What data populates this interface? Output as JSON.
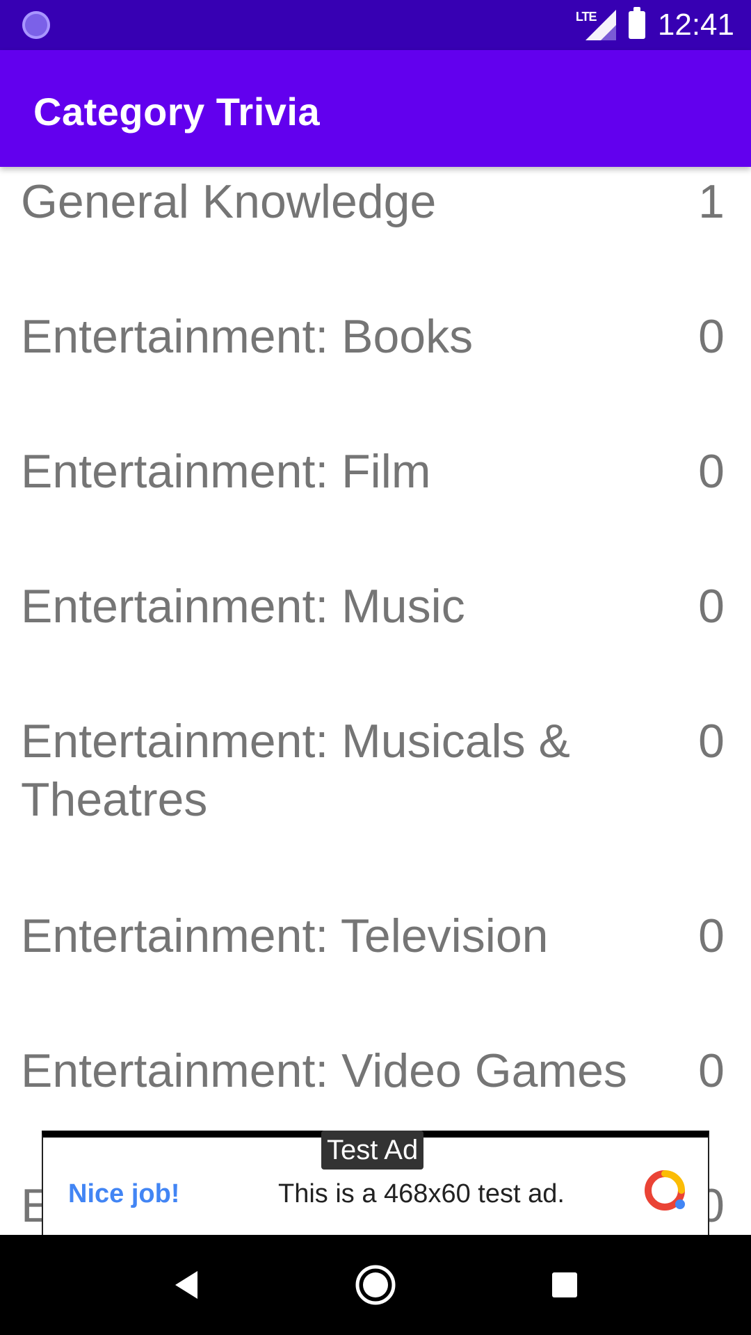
{
  "status_bar": {
    "network": "LTE",
    "time": "12:41"
  },
  "app_bar": {
    "title": "Category Trivia"
  },
  "categories": [
    {
      "name": "General Knowledge",
      "count": "1"
    },
    {
      "name": "Entertainment: Books",
      "count": "0"
    },
    {
      "name": "Entertainment: Film",
      "count": "0"
    },
    {
      "name": "Entertainment: Music",
      "count": "0"
    },
    {
      "name": "Entertainment: Musicals & Theatres",
      "count": "0"
    },
    {
      "name": "Entertainment: Television",
      "count": "0"
    },
    {
      "name": "Entertainment: Video Games",
      "count": "0"
    },
    {
      "name": "E",
      "count": "0"
    }
  ],
  "ad": {
    "tag": "Test Ad",
    "headline": "Nice job!",
    "body": "This is a 468x60 test ad."
  },
  "nav_bar": {
    "icons": [
      "back-icon",
      "home-icon",
      "recents-icon"
    ]
  },
  "colors": {
    "status_bar": "#3700b3",
    "app_bar": "#6200ee",
    "list_text": "#757575"
  }
}
